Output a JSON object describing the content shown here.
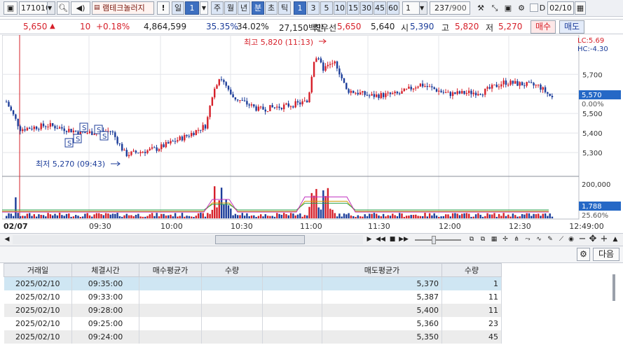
{
  "toolbar": {
    "code": "171010",
    "stock_name": "램테크놀러지",
    "period_value": "1",
    "periods": [
      "일",
      "주",
      "월",
      "년",
      "분",
      "초",
      "틱"
    ],
    "minute_options": [
      "1",
      "3",
      "5",
      "10",
      "15",
      "30",
      "45",
      "60"
    ],
    "custom_value": "1",
    "count": "237",
    "count_max": "/900",
    "date_checkbox": "D",
    "date": "02/10",
    "exclamation": "!"
  },
  "quote": {
    "price": "5,650",
    "change_arrow": "▲",
    "change": "10",
    "change_pct": "+0.18%",
    "volume": "4,864,599",
    "pct1": "35.35%",
    "pct2": "34.02%",
    "amount": "27,150백만",
    "best_label": "최우선",
    "best_ask": "5,650",
    "best_bid": "5,640",
    "open_label": "시",
    "open": "5,390",
    "high_label": "고",
    "high": "5,820",
    "low_label": "저",
    "low": "5,270",
    "buy_label": "매수",
    "sell_label": "매도"
  },
  "chart_data": {
    "type": "candlestick",
    "date": "02/07",
    "x_ticks": [
      "09:30",
      "10:00",
      "10:30",
      "11:00",
      "11:30",
      "12:00",
      "12:30",
      "12:49:00"
    ],
    "y_ticks": [
      "5,700",
      "5,600",
      "5,500",
      "5,400",
      "5,300"
    ],
    "ylim": [
      5200,
      5880
    ],
    "current_price_label": "5,570",
    "current_pct_label": "0.00%",
    "lc_label": "LC:5.69",
    "hc_label": "HC:-4.30",
    "high_annotation": "최고 5,820 (11:13)",
    "low_annotation": "최저 5,270 (09:43)",
    "signal_marks": [
      "S",
      "S",
      "S",
      "S",
      "S"
    ],
    "volume_ticks": [
      "200,000"
    ],
    "volume_current": "1,788",
    "volume_pct": "25.60%",
    "colors": {
      "up": "#d6202a",
      "down": "#1c3d9a",
      "current_bg": "#2568c6"
    }
  },
  "panel": {
    "next_label": "다음",
    "columns": [
      "거래일",
      "체결시간",
      "매수평균가",
      "수량",
      "",
      "매도평균가",
      "수량"
    ],
    "rows": [
      [
        "2025/02/10",
        "09:35:00",
        "",
        "",
        "",
        "5,370",
        "1"
      ],
      [
        "2025/02/10",
        "09:33:00",
        "",
        "",
        "",
        "5,387",
        "11"
      ],
      [
        "2025/02/10",
        "09:28:00",
        "",
        "",
        "",
        "5,400",
        "11"
      ],
      [
        "2025/02/10",
        "09:25:00",
        "",
        "",
        "",
        "5,360",
        "23"
      ],
      [
        "2025/02/10",
        "09:24:00",
        "",
        "",
        "",
        "5,350",
        "45"
      ]
    ]
  }
}
